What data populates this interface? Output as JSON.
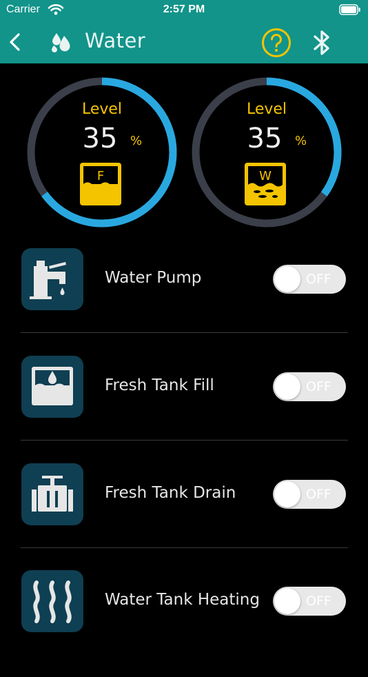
{
  "status_bar": {
    "carrier": "Carrier",
    "time": "2:57 PM"
  },
  "nav": {
    "title": "Water",
    "accent": "#f5c400",
    "background": "#12948a"
  },
  "gauges": [
    {
      "label": "Level",
      "value": "35",
      "unit": "%",
      "tank_letter": "F",
      "fill_fraction": 0.65,
      "ring_color": "#29a8e0",
      "track_color": "#3b3f4a"
    },
    {
      "label": "Level",
      "value": "35",
      "unit": "%",
      "tank_letter": "W",
      "fill_fraction": 0.35,
      "ring_color": "#29a8e0",
      "track_color": "#3b3f4a"
    }
  ],
  "controls": [
    {
      "label": "Water Pump",
      "state": "OFF",
      "icon": "faucet-icon"
    },
    {
      "label": "Fresh Tank Fill",
      "state": "OFF",
      "icon": "tank-fill-icon"
    },
    {
      "label": "Fresh Tank Drain",
      "state": "OFF",
      "icon": "tank-drain-icon"
    },
    {
      "label": "Water Tank Heating",
      "state": "OFF",
      "icon": "heating-icon"
    }
  ]
}
